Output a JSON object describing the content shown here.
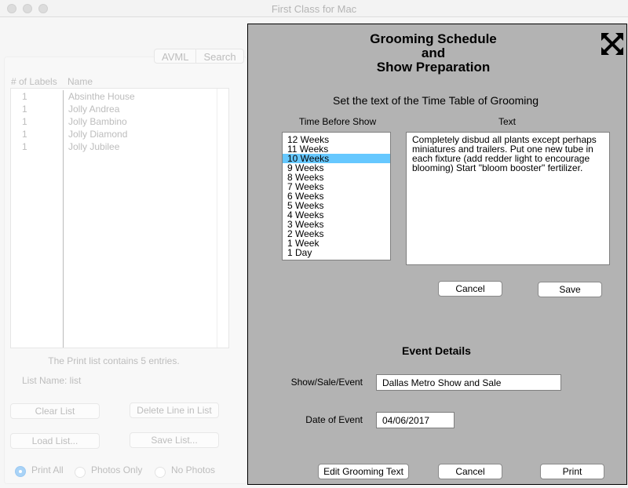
{
  "window": {
    "title": "First Class for Mac"
  },
  "left": {
    "tabs": [
      "AVML",
      "Search"
    ],
    "columns": [
      "# of Labels",
      "Name"
    ],
    "rows": [
      {
        "count": "1",
        "name": "Absinthe House"
      },
      {
        "count": "1",
        "name": "Jolly Andrea"
      },
      {
        "count": "1",
        "name": "Jolly Bambino"
      },
      {
        "count": "1",
        "name": "Jolly Diamond"
      },
      {
        "count": "1",
        "name": "Jolly Jubilee"
      }
    ],
    "status": "The Print list contains 5 entries.",
    "list_name": "List Name: list",
    "buttons": {
      "clear": "Clear List",
      "delete": "Delete Line in List",
      "load": "Load List...",
      "save": "Save List..."
    },
    "radios": [
      {
        "label": "Print All",
        "selected": true
      },
      {
        "label": "Photos Only",
        "selected": false
      },
      {
        "label": "No Photos",
        "selected": false
      }
    ]
  },
  "dialog": {
    "title_lines": [
      "Grooming Schedule",
      "and",
      "Show Preparation"
    ],
    "close_icon": "close-arrows-icon",
    "subtitle": "Set the text of the Time Table of Grooming",
    "time_header": "Time Before Show",
    "text_header": "Text",
    "times": [
      "12 Weeks",
      "11 Weeks",
      "10 Weeks",
      "9 Weeks",
      "8 Weeks",
      "7 Weeks",
      "6 Weeks",
      "5 Weeks",
      "4 Weeks",
      "3 Weeks",
      "2 Weeks",
      "1 Week",
      "1 Day"
    ],
    "selected_time": "10 Weeks",
    "text_value": "Completely disbud all plants except perhaps miniatures and trailers. Put one new tube in each fixture (add redder light to encourage blooming) Start \"bloom booster\" fertilizer.",
    "cancel_label": "Cancel",
    "save_label": "Save",
    "event_header": "Event Details",
    "show_label": "Show/Sale/Event",
    "show_value": "Dallas Metro Show and Sale",
    "date_label": "Date of Event",
    "date_value": "04/06/2017",
    "edit_label": "Edit Grooming Text",
    "cancel2_label": "Cancel",
    "print_label": "Print",
    "highlight_color": "#66c8ff"
  }
}
